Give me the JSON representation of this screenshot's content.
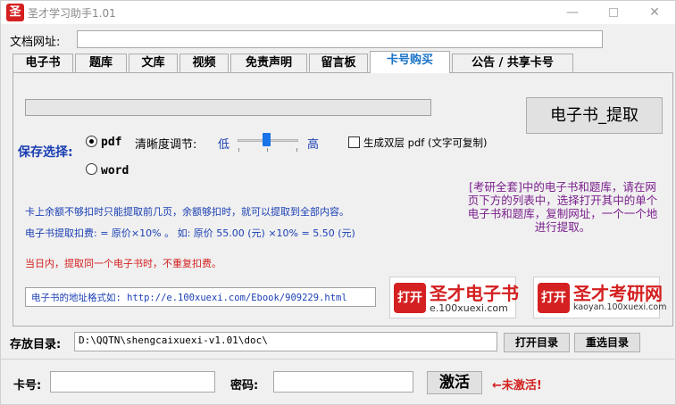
{
  "window": {
    "title": "圣才学习助手1.01",
    "icon_glyph": "圣"
  },
  "url_label": "文档网址:",
  "url_value": "",
  "tabs": [
    {
      "label": "电子书"
    },
    {
      "label": "题库"
    },
    {
      "label": "文库"
    },
    {
      "label": "视频"
    },
    {
      "label": "免责声明"
    },
    {
      "label": "留言板"
    },
    {
      "label": "卡号购买"
    },
    {
      "label": "公告 / 共享卡号"
    }
  ],
  "progress": {
    "value": 0
  },
  "extract_button": "电子书_提取",
  "save": {
    "label": "保存选择:",
    "options": [
      {
        "label": "pdf",
        "checked": true
      },
      {
        "label": "word",
        "checked": false
      }
    ]
  },
  "clarity": {
    "label": "清晰度调节:",
    "low": "低",
    "high": "高"
  },
  "dual_layer": {
    "label": "生成双层 pdf (文字可复制)",
    "checked": false
  },
  "info": {
    "line1": "卡上余额不够扣时只能提取前几页，余额够扣时，就可以提取到全部内容。",
    "line2": "电子书提取扣费: = 原价×10% 。 如: 原价 55.00 (元) ×10% = 5.50 (元)",
    "line3": "当日内，提取同一个电子书时，不重复扣费。"
  },
  "note": "[考研全套]中的电子书和题库，请在网页下方的列表中，选择打开其中的单个电子书和题库，复制网址，一个一个地进行提取。",
  "url_format": "电子书的地址格式如: http://e.100xuexi.com/Ebook/909229.html",
  "ads": [
    {
      "open": "打开",
      "title": "圣才电子书",
      "sub": "e.100xuexi.com",
      "color": "#d42020"
    },
    {
      "open": "打开",
      "title": "圣才考研网",
      "sub": "kaoyan.100xuexi.com",
      "color": "#d42020"
    }
  ],
  "dir": {
    "label": "存放目录:",
    "value": "D:\\QQTN\\shengcaixuexi-v1.01\\doc\\",
    "open_button": "打开目录",
    "reselect_button": "重选目录"
  },
  "card": {
    "label": "卡号:",
    "value": ""
  },
  "password": {
    "label": "密码:",
    "value": ""
  },
  "activate_button": "激活",
  "status": "←未激活!"
}
